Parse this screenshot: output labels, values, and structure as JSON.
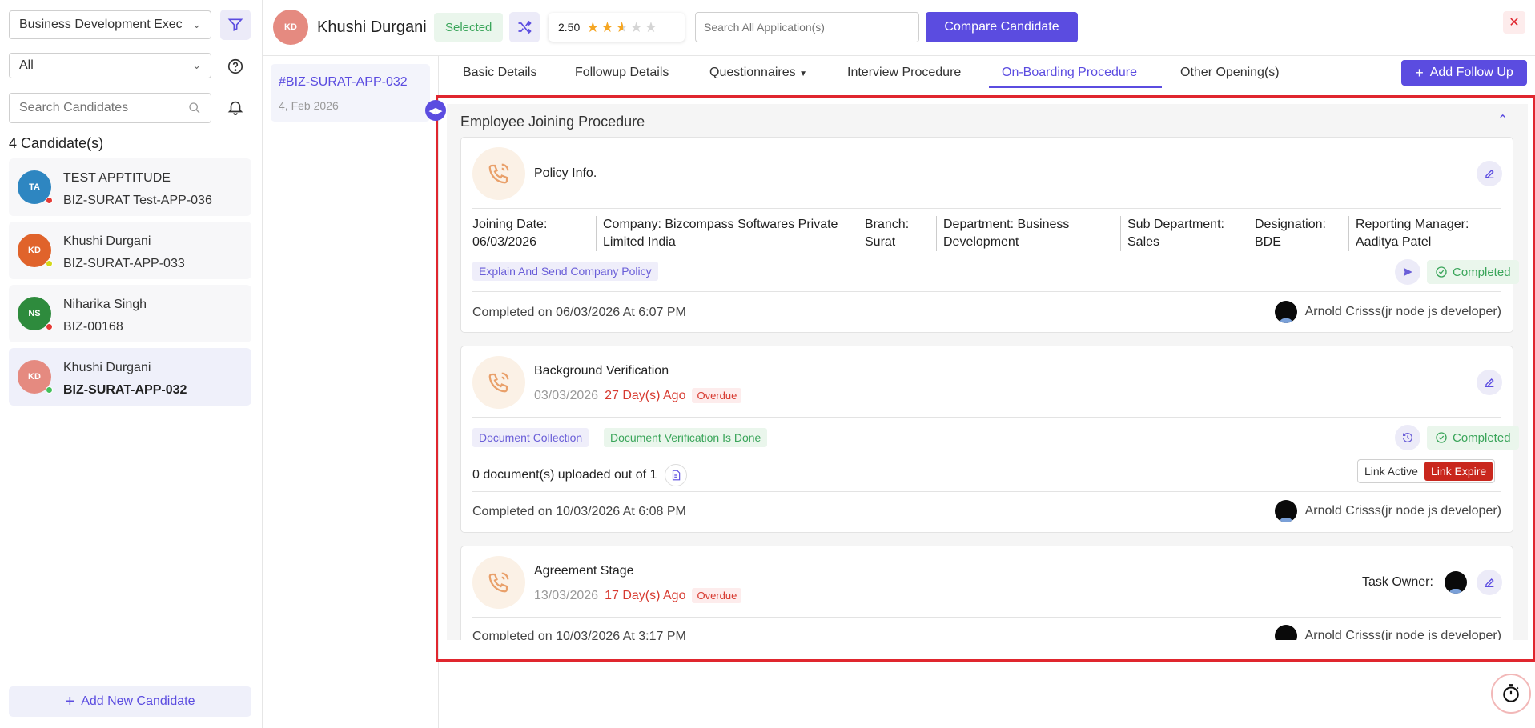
{
  "sidebar": {
    "job_select": "Business Development Exec",
    "status_select": "All",
    "search_placeholder": "Search Candidates",
    "count_label": "4 Candidate(s)",
    "add_label": "Add New Candidate",
    "candidates": [
      {
        "initials": "TA",
        "name": "TEST APPTITUDE",
        "code": "BIZ-SURAT Test-APP-036",
        "avatar_color": "#2e86c1",
        "dot_color": "#e53935"
      },
      {
        "initials": "KD",
        "name": "Khushi Durgani",
        "code": "BIZ-SURAT-APP-033",
        "avatar_color": "#e0632b",
        "dot_color": "#d4d81a"
      },
      {
        "initials": "NS",
        "name": "Niharika Singh",
        "code": "BIZ-00168",
        "avatar_color": "#2e8b3d",
        "dot_color": "#e53935"
      },
      {
        "initials": "KD",
        "name": "Khushi Durgani",
        "code": "BIZ-SURAT-APP-032",
        "avatar_color": "#e58a80",
        "dot_color": "#43c05b"
      }
    ]
  },
  "header": {
    "initials": "KD",
    "name": "Khushi Durgani",
    "status": "Selected",
    "rating": "2.50",
    "rating_value": 2.5,
    "rating_max": 5,
    "search_placeholder": "Search All Application(s)",
    "compare_label": "Compare Candidate"
  },
  "application": {
    "code": "#BIZ-SURAT-APP-032",
    "date": "4, Feb 2026"
  },
  "tabs": {
    "items": [
      "Basic Details",
      "Followup Details",
      "Questionnaires",
      "Interview Procedure",
      "On-Boarding Procedure",
      "Other Opening(s)"
    ],
    "active": "On-Boarding Procedure",
    "add_followup": "Add Follow Up"
  },
  "section": {
    "title": "Employee Joining Procedure",
    "cards": [
      {
        "title": "Policy Info.",
        "info": [
          {
            "label": "Joining Date:",
            "value": "06/03/2026"
          },
          {
            "label": "Company: Bizcompass Softwares Private",
            "value": "Limited India"
          },
          {
            "label": "Branch:",
            "value": "Surat"
          },
          {
            "label": "Department: Business",
            "value": "Development"
          },
          {
            "label": "Sub Department:",
            "value": "Sales"
          },
          {
            "label": "Designation:",
            "value": "BDE"
          },
          {
            "label": "Reporting Manager:",
            "value": "Aaditya Patel"
          }
        ],
        "tags": [
          "Explain And Send Company Policy"
        ],
        "status": "Completed",
        "completed_on": "Completed on 06/03/2026 At 6:07 PM",
        "user": "Arnold Crisss(jr node js developer)"
      },
      {
        "title": "Background Verification",
        "date": "03/03/2026",
        "ago": "27 Day(s) Ago",
        "overdue": "Overdue",
        "tags": [
          "Document Collection",
          "Document Verification Is Done"
        ],
        "status": "Completed",
        "docs": "0 document(s) uploaded out of 1",
        "link_active": "Link Active",
        "link_expire": "Link Expire",
        "completed_on": "Completed on 10/03/2026 At 6:08 PM",
        "user": "Arnold Crisss(jr node js developer)"
      },
      {
        "title": "Agreement Stage",
        "date": "13/03/2026",
        "ago": "17 Day(s) Ago",
        "overdue": "Overdue",
        "task_owner": "Task Owner:",
        "completed_on": "Completed on 10/03/2026 At 3:17 PM",
        "user": "Arnold Crisss(jr node js developer)"
      }
    ]
  },
  "colors": {
    "accent": "#5b4ce0",
    "danger": "#e0262e",
    "success": "#3aa55a"
  }
}
